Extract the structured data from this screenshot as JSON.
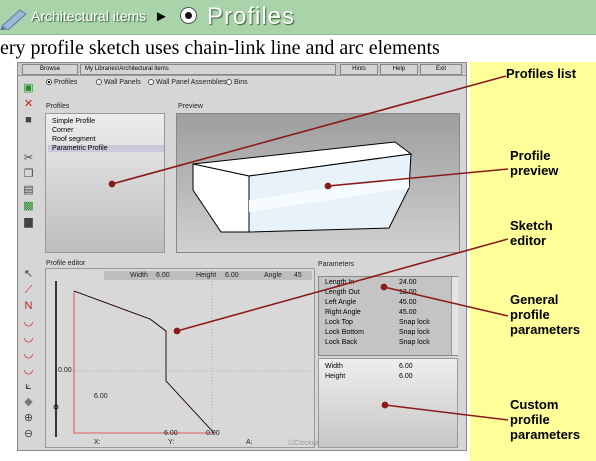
{
  "banner": {
    "crumb": "Architectural items",
    "arrow": "►",
    "current": "Profiles"
  },
  "subtitle": "ery profile sketch uses chain-link line and arc elements",
  "menubar": {
    "browse": "Browse",
    "path": "My Libraries\\Architectural items",
    "hints": "Hints",
    "help": "Help",
    "exit": "Exit"
  },
  "categories": {
    "profiles": "Profiles",
    "wall_panels": "Wall Panels",
    "wall_panel_assemblies": "Wall Panel Assemblies",
    "bins": "Bins",
    "selected": "Profiles"
  },
  "profiles_list": {
    "label": "Profiles",
    "items": [
      "Simple Profile",
      "Corner",
      "Roof segment",
      "Parametric Profile"
    ]
  },
  "preview": {
    "label": "Preview"
  },
  "editor": {
    "label": "Profile editor",
    "width_label": "Width",
    "width_value": "6.00",
    "height_label": "Height",
    "height_value": "6.00",
    "angle_label": "Angle",
    "angle_value": "45",
    "y_zero": "0.00",
    "left_dim": "6.00",
    "bottom_dim_a": "6.00",
    "bottom_dim_b": "0.00",
    "x_label": "X:",
    "y_label": "Y:",
    "a_label": "A:",
    "clockwise": "Clockwis"
  },
  "parameters": {
    "label": "Parameters",
    "general": [
      {
        "name": "Length In",
        "value": "24.00"
      },
      {
        "name": "Length Out",
        "value": "12.00"
      },
      {
        "name": "Left Angle",
        "value": "45.00"
      },
      {
        "name": "Right Angle",
        "value": "45.00"
      },
      {
        "name": "Lock Top",
        "value": "Snap lock"
      },
      {
        "name": "Lock Bottom",
        "value": "Snap lock"
      },
      {
        "name": "Lock Back",
        "value": "Snap lock"
      }
    ],
    "custom": [
      {
        "name": "Width",
        "value": "6.00"
      },
      {
        "name": "Height",
        "value": "6.00"
      }
    ]
  },
  "callouts": {
    "profiles_list": "Profiles list",
    "profile_preview_1": "Profile",
    "profile_preview_2": "preview",
    "sketch_editor_1": "Sketch",
    "sketch_editor_2": "editor",
    "general_1": "General",
    "general_2": "profile",
    "general_3": "parameters",
    "custom_1": "Custom",
    "custom_2": "profile",
    "custom_3": "parameters"
  },
  "colors": {
    "banner": "#a9d3a9",
    "callout_bg": "#ffff99",
    "leader_line": "#8b1a1a",
    "sketch_line": "#e03030"
  }
}
